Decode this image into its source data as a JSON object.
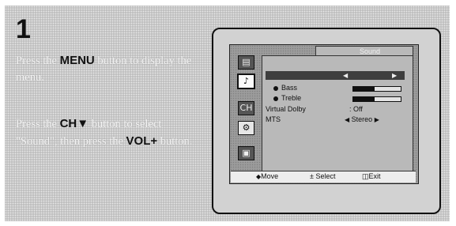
{
  "step": {
    "number": "1"
  },
  "instructions": {
    "i1": {
      "pre": "Press the ",
      "key": "MENU",
      "post": " button to display the menu."
    },
    "i2": {
      "pre": "Press the ",
      "key": "CH▼",
      "post": " button to select \"Sound\", then press the ",
      "key2": "VOL+",
      "post2": " button."
    }
  },
  "osd": {
    "menu_title": "Sound",
    "rows": [
      {
        "label": "",
        "value": "",
        "highlighted": true
      },
      {
        "label": "Bass",
        "bar_level": 0.45
      },
      {
        "label": "Treble",
        "bar_level": 0.45
      },
      {
        "label": "Virtual Dolby",
        "value": ": Off"
      },
      {
        "label": "MTS",
        "value": "Stereo"
      }
    ],
    "footer": {
      "move": "Move",
      "select": "Select",
      "exit": "Exit"
    }
  },
  "icons": [
    "picture-icon",
    "sound-icon",
    "channel-icon",
    "setup-icon",
    "input-icon"
  ]
}
